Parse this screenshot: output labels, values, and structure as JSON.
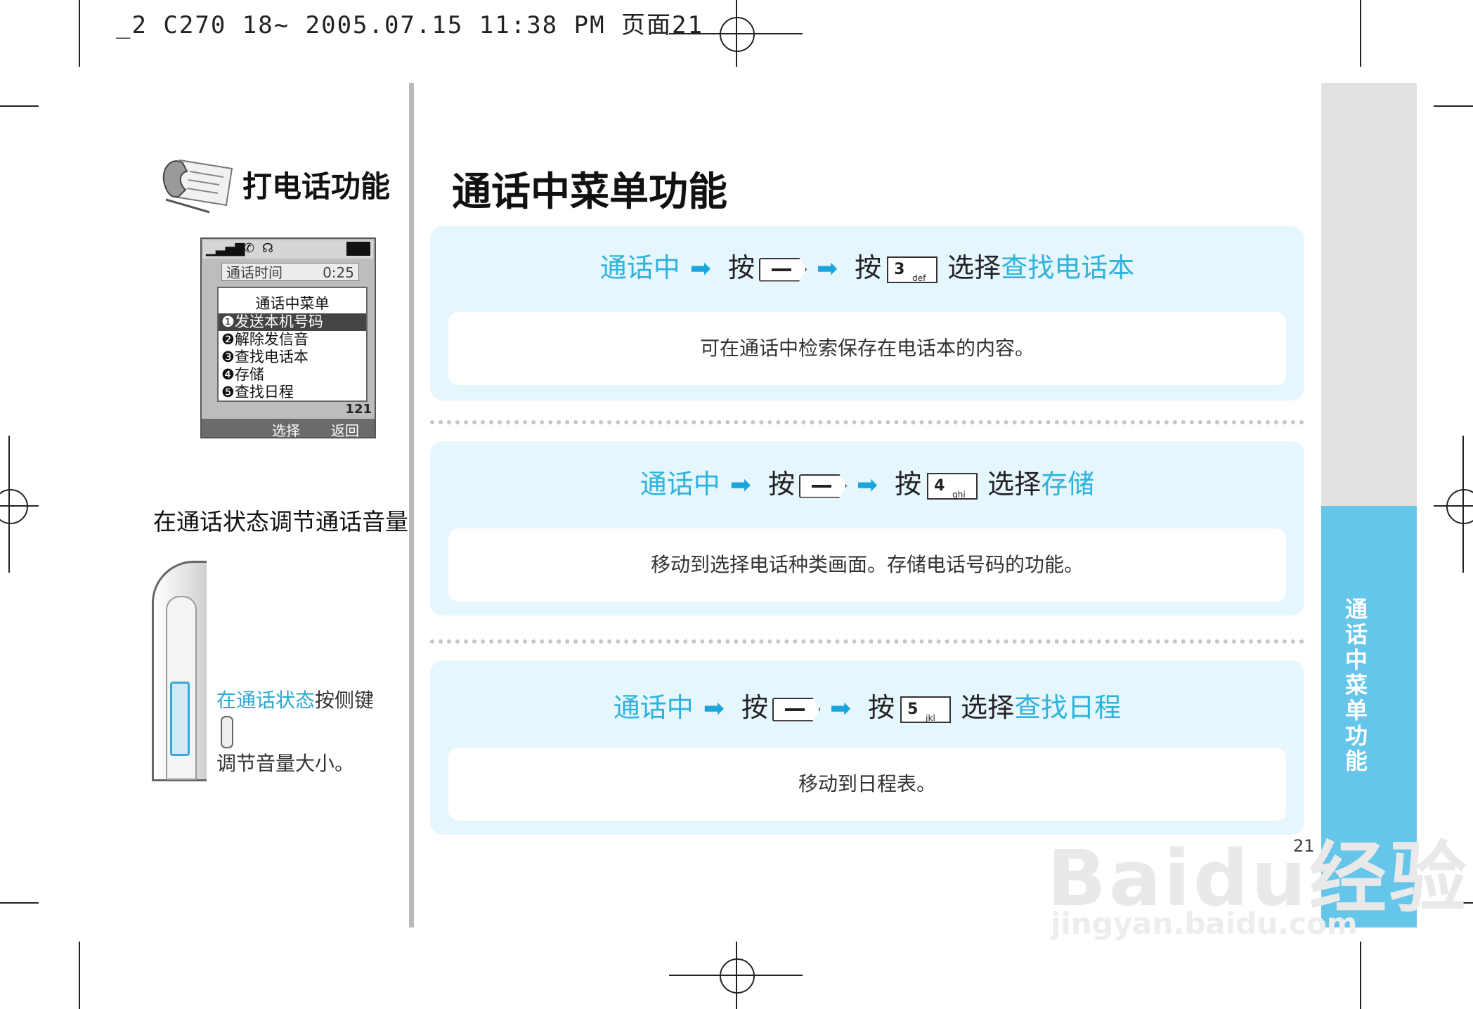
{
  "header": {
    "print_info": "_2 C270 18~ 2005.07.15 11:38 PM 页面21"
  },
  "left": {
    "section_title": "打电话功能",
    "phone_screen": {
      "call_time_label": "通话时间",
      "call_time_value": "0:25",
      "menu_title": "通话中菜单",
      "menu_items": [
        "发送本机号码",
        "解除发信音",
        "查找电话本",
        "存储",
        "查找日程"
      ],
      "counter": "121",
      "softkey_left": "选择",
      "softkey_right": "返回"
    },
    "volume_heading": "在通话状态调节通话音量",
    "volume_note_highlight": "在通话状态",
    "volume_note_rest1": "按侧键",
    "volume_note_rest2": "调节音量大小。"
  },
  "main": {
    "title": "通话中菜单功能",
    "in_call": "通话中",
    "press": "按",
    "select": "选择",
    "steps": [
      {
        "key_digit": "3",
        "key_letters": "def",
        "target": "查找电话本",
        "description": "可在通话中检索保存在电话本的内容。"
      },
      {
        "key_digit": "4",
        "key_letters": "ghi",
        "target": "存储",
        "description": "移动到选择电话种类画面。存储电话号码的功能。"
      },
      {
        "key_digit": "5",
        "key_letters": "jkl",
        "target": "查找日程",
        "description": "移动到日程表。"
      }
    ]
  },
  "side_tab": {
    "label": "通话中菜单功能"
  },
  "page_number": "21",
  "watermark": {
    "text": "Baidu经验",
    "url": "jingyan.baidu.com"
  }
}
